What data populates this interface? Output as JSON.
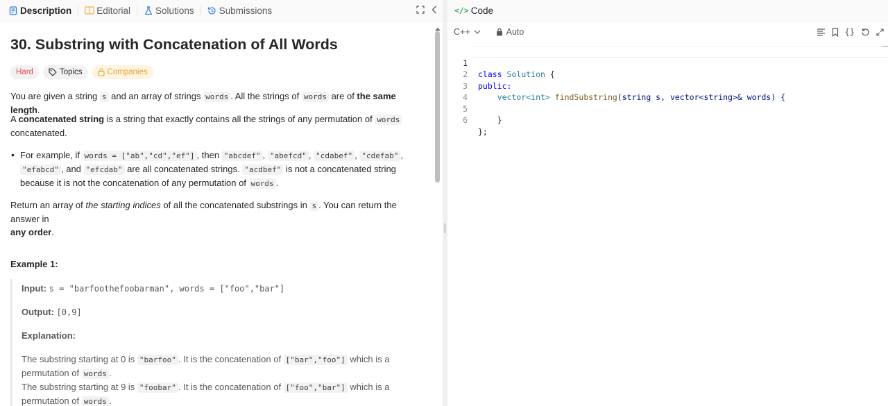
{
  "tabs": {
    "description": "Description",
    "editorial": "Editorial",
    "solutions": "Solutions",
    "submissions": "Submissions"
  },
  "problem": {
    "title": "30. Substring with Concatenation of All Words",
    "difficulty": "Hard",
    "topics_label": "Topics",
    "companies_label": "Companies"
  },
  "description": {
    "p1_a": "You are given a string ",
    "p1_s": "s",
    "p1_b": " and an array of strings ",
    "p1_words": "words",
    "p1_c": ". All the strings of ",
    "p1_words2": "words",
    "p1_d": " are of ",
    "p1_bold": "the same length",
    "p1_e": ".",
    "p2_a": "A ",
    "p2_bold": "concatenated string",
    "p2_b": " is a string that exactly contains all the strings of any permutation of ",
    "p2_words": "words",
    "p2_c": "concatenated.",
    "bullet_a": "For example, if ",
    "bullet_code1": "words = [\"ab\",\"cd\",\"ef\"]",
    "bullet_b": ", then ",
    "bullet_c1": "\"abcdef\"",
    "bullet_c2": "\"abefcd\"",
    "bullet_c3": "\"cdabef\"",
    "bullet_c4": "\"cdefab\"",
    "bullet_c5": "\"efabcd\"",
    "bullet_and": ", and ",
    "bullet_c6": "\"efcdab\"",
    "bullet_d": " are all concatenated strings. ",
    "bullet_c7": "\"acdbef\"",
    "bullet_e": " is not a concatenated string",
    "bullet_f": "because it is not the concatenation of any permutation of ",
    "bullet_words": "words",
    "bullet_g": ".",
    "p3_a": "Return an array of ",
    "p3_italic": "the starting indices",
    "p3_b": " of all the concatenated substrings in ",
    "p3_s": "s",
    "p3_c": ". You can return the answer in",
    "p3_bold": "any order",
    "p3_d": "."
  },
  "example": {
    "title": "Example 1:",
    "input_label": "Input:",
    "input_value": "s = \"barfoothefoobarman\", words = [\"foo\",\"bar\"]",
    "output_label": "Output:",
    "output_value": "[0,9]",
    "explanation_label": "Explanation:",
    "e1_a": "The substring starting at 0 is ",
    "e1_code": "\"barfoo\"",
    "e1_b": ". It is the concatenation of ",
    "e1_code2": "[\"bar\",\"foo\"]",
    "e1_c": " which is a",
    "e1_d": "permutation of ",
    "e1_words": "words",
    "e1_e": ".",
    "e2_a": "The substring starting at 9 is ",
    "e2_code": "\"foobar\"",
    "e2_b": ". It is the concatenation of ",
    "e2_code2": "[\"foo\",\"bar\"]",
    "e2_c": " which is a",
    "e2_d": "permutation of ",
    "e2_words": "words",
    "e2_e": "."
  },
  "editor": {
    "header_title": "Code",
    "language": "C++",
    "mode": "Auto",
    "lines": [
      {
        "n": "1",
        "t1": "class ",
        "t2": "Solution",
        "t3": " {"
      },
      {
        "n": "2",
        "t1": "public:"
      },
      {
        "n": "3",
        "t1": "    vector<int> ",
        "t2": "findSubstring",
        "t3": "(string s, vector<string>& words) {"
      },
      {
        "n": "4",
        "t1": ""
      },
      {
        "n": "5",
        "t1": "    }"
      },
      {
        "n": "6",
        "t1": "};"
      }
    ]
  },
  "icons": [
    "description-icon",
    "editorial-icon",
    "solutions-icon",
    "submissions-icon",
    "fullscreen-icon",
    "collapse-icon",
    "code-icon",
    "chevron-down-icon",
    "lock-icon",
    "format-icon",
    "bookmark-icon",
    "braces-icon",
    "reset-icon",
    "expand-icon",
    "tag-icon"
  ],
  "colors": {
    "hard": "#e04b4b",
    "companies": "#e0a43a",
    "description_icon": "#2b78e4",
    "code_icon": "#3ba55c"
  }
}
